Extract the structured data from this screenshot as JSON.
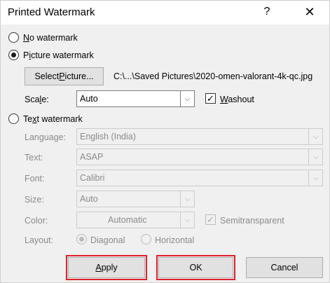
{
  "dialog": {
    "title": "Printed Watermark",
    "help_glyph": "?",
    "close_glyph": "✕"
  },
  "options": {
    "no_watermark": {
      "underline": "N",
      "rest": "o watermark",
      "selected": false
    },
    "picture_watermark": {
      "pre": "P",
      "underline": "i",
      "rest": "cture watermark",
      "selected": true
    },
    "text_watermark": {
      "pre": "Te",
      "underline": "x",
      "rest": "t watermark",
      "selected": false
    }
  },
  "picture": {
    "select_button": {
      "pre": "Select ",
      "underline": "P",
      "rest": "icture..."
    },
    "path": "C:\\...\\Saved Pictures\\2020-omen-valorant-4k-qc.jpg",
    "scale_label": {
      "pre": "Sca",
      "underline": "l",
      "rest": "e:"
    },
    "scale_value": "Auto",
    "washout": {
      "underline": "W",
      "rest": "ashout",
      "checked": true
    }
  },
  "text": {
    "language_label": "Language:",
    "language_value": "English (India)",
    "text_label": "Text:",
    "text_value": "ASAP",
    "font_label": "Font:",
    "font_value": "Calibri",
    "size_label": "Size:",
    "size_value": "Auto",
    "color_label": "Color:",
    "color_value": "Automatic",
    "semitransparent": {
      "label": "Semitransparent",
      "checked": true
    },
    "layout_label": "Layout:",
    "layout_diagonal": {
      "label": "Diagonal",
      "selected": true
    },
    "layout_horizontal": {
      "label": "Horizontal",
      "selected": false
    }
  },
  "buttons": {
    "apply": {
      "underline": "A",
      "rest": "pply"
    },
    "ok": "OK",
    "cancel": "Cancel"
  },
  "colors": {
    "highlight": "#e0202a",
    "dialog_bg": "#f0f0f0",
    "disabled_text": "#8a8a8a"
  }
}
